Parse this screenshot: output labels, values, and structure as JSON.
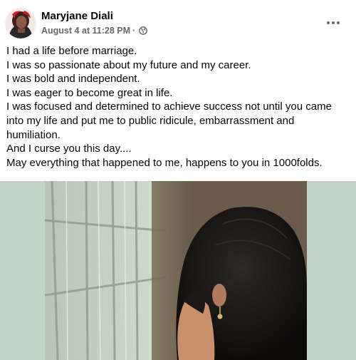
{
  "post": {
    "author": "Maryjane Diali",
    "timestamp": "August 4 at 11:28 PM",
    "separator": "·",
    "audience_icon": "globe-icon",
    "more_icon": "more-options-icon",
    "lines": [
      "I had a life before marriage.",
      "I was so passionate about my future and my career.",
      "I was bold and independent.",
      "I was eager to become great in life.",
      "I was focused and determined to achieve success not until you came",
      "into my life and put me to public ridicule, embarrassment and",
      "humiliation.",
      "And I curse you this day....",
      "May everything that happened to me, happens to you in 1000folds."
    ]
  },
  "colors": {
    "text": "#050505",
    "secondary": "#65676b",
    "photo_background": "#c0d3c4"
  }
}
